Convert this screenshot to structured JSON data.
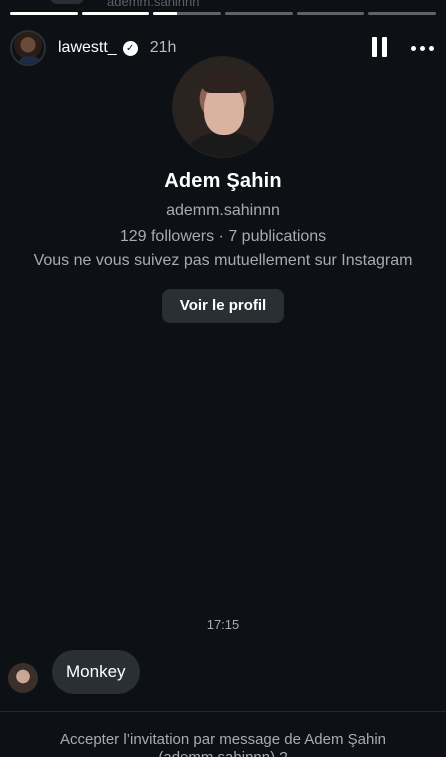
{
  "story": {
    "ghost_text": "ademm.sahinnn",
    "progress": [
      1,
      1,
      0.35,
      0,
      0,
      0
    ],
    "header": {
      "username": "lawestt_",
      "time": "21h"
    }
  },
  "profile": {
    "name": "Adem Şahin",
    "handle": "ademm.sahinnn",
    "stats": "129 followers · 7 publications",
    "mutual": "Vous ne vous suivez pas mutuellement sur Instagram",
    "view_button": "Voir le profil"
  },
  "conversation": {
    "timestamp": "17:15",
    "message": "Monkey",
    "invite_line1": "Accepter l’invitation par message de Adem Şahin",
    "invite_line2": "(ademm.sahinnn) ?"
  },
  "colors": {
    "background": "#0d1014",
    "bubble": "#2a2f34",
    "muted_text": "#a8acb2"
  },
  "icons": {
    "verified": "verified-icon",
    "pause": "pause-icon",
    "more": "more-icon"
  }
}
